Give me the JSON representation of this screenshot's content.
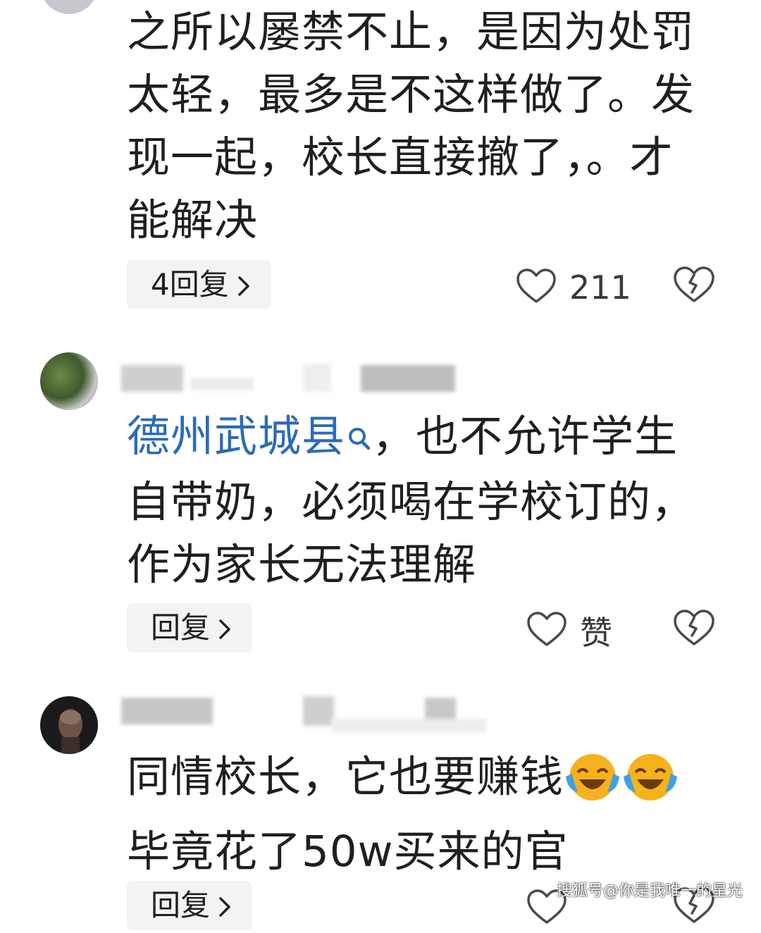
{
  "comments": [
    {
      "text": "之所以屡禁不止，是因为处罚太轻，最多是不这样做了。发现一起，校长直接撤了，。才能解决",
      "reply_label": "4回复",
      "like_count": "211"
    },
    {
      "mention": "德州武城县",
      "text": "，也不允许学生自带奶，必须喝在学校订的，作为家长无法理解",
      "reply_label": "回复",
      "like_label": "赞"
    },
    {
      "text": "同情校长，它也要赚钱",
      "emojis": [
        "laugh-cry-emoji",
        "laugh-cry-emoji"
      ],
      "text_line2": "毕竟花了50w买来的官",
      "reply_label": "回复"
    }
  ],
  "watermark": "搜狐号@你是我唯一的星光",
  "colors": {
    "mention": "#2c6bb5",
    "reply_bg": "#f3f3f3",
    "text": "#1f1f1f"
  }
}
